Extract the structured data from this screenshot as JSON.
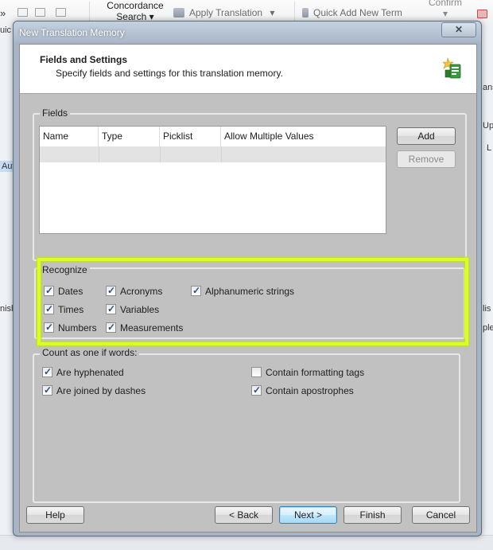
{
  "background_app": {
    "toolbar": {
      "concordance_line1": "Concordance",
      "concordance_line2": "Search",
      "apply_translation": "Apply Translation",
      "quick_add": "Quick Add New Term",
      "confirm": "Confirm",
      "dropdown_glyph": "▾"
    },
    "fragments": {
      "left_top": "uic",
      "left_mid1": "Aut",
      "left_mid2": "nish",
      "right_1": "ans",
      "right_2": "Up",
      "right_3": "L",
      "right_4": "lis",
      "right_5": "ple"
    }
  },
  "dialog": {
    "title": "New Translation Memory",
    "close_glyph": "✕",
    "header": {
      "title": "Fields and Settings",
      "subtitle": "Specify fields and settings for this translation memory.",
      "icon": "translation-memory-icon"
    },
    "fields": {
      "group_label": "Fields",
      "columns": [
        "Name",
        "Type",
        "Picklist",
        "Allow Multiple Values"
      ],
      "add_label": "Add",
      "remove_label": "Remove"
    },
    "recognize": {
      "group_label": "Recognize",
      "options": [
        {
          "label": "Dates",
          "checked": true
        },
        {
          "label": "Acronyms",
          "checked": true
        },
        {
          "label": "Alphanumeric strings",
          "checked": true
        },
        {
          "label": "Times",
          "checked": true
        },
        {
          "label": "Variables",
          "checked": true
        },
        {
          "label": "Numbers",
          "checked": true
        },
        {
          "label": "Measurements",
          "checked": true
        }
      ]
    },
    "count_words": {
      "group_label": "Count as one if words:",
      "options": [
        {
          "label": "Are hyphenated",
          "checked": true
        },
        {
          "label": "Contain formatting tags",
          "checked": false
        },
        {
          "label": "Are joined by dashes",
          "checked": true
        },
        {
          "label": "Contain apostrophes",
          "checked": true
        }
      ]
    },
    "buttons": {
      "help": "Help",
      "back": "< Back",
      "next": "Next >",
      "finish": "Finish",
      "cancel": "Cancel"
    },
    "colors": {
      "highlight": "#dcff1f",
      "dialog_body": "#c1c1c1",
      "title_text": "#ffffff",
      "checkmark": "#2b4f86"
    }
  }
}
